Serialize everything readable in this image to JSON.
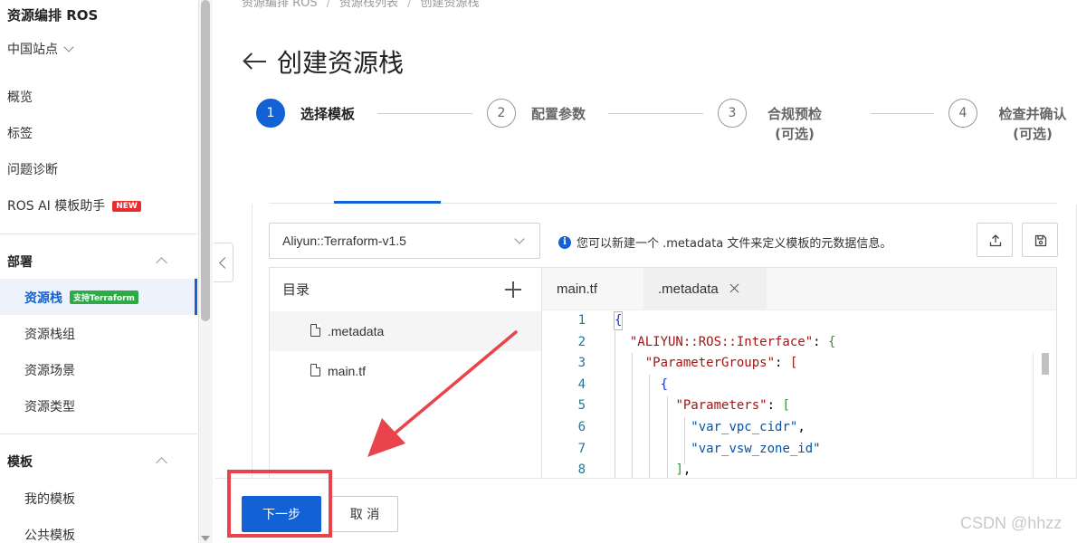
{
  "sidebar": {
    "title": "资源编排 ROS",
    "region": "中国站点",
    "items": [
      {
        "label": "概览"
      },
      {
        "label": "标签"
      },
      {
        "label": "问题诊断"
      },
      {
        "label": "ROS AI 模板助手",
        "badge": "NEW"
      }
    ],
    "sections": [
      {
        "label": "部署",
        "items": [
          {
            "label": "资源栈",
            "badge": "支持Terraform",
            "active": true
          },
          {
            "label": "资源栈组"
          },
          {
            "label": "资源场景"
          },
          {
            "label": "资源类型"
          }
        ]
      },
      {
        "label": "模板",
        "items": [
          {
            "label": "我的模板"
          },
          {
            "label": "公共模板"
          }
        ]
      }
    ]
  },
  "breadcrumb": [
    "资源编排 ROS",
    "资源栈列表",
    "创建资源栈"
  ],
  "page_title": "创建资源栈",
  "steps": [
    {
      "num": "1",
      "label": "选择模板",
      "sub": "",
      "active": true
    },
    {
      "num": "2",
      "label": "配置参数",
      "sub": "",
      "active": false
    },
    {
      "num": "3",
      "label": "合规预检",
      "sub": "(可选)",
      "active": false
    },
    {
      "num": "4",
      "label": "检查并确认",
      "sub": "(可选)",
      "active": false
    }
  ],
  "template_select": {
    "value": "Aliyun::Terraform-v1.5"
  },
  "info_text": "您可以新建一个 .metadata 文件来定义模板的元数据信息。",
  "file_tree": {
    "title": "目录",
    "files": [
      ".metadata",
      "main.tf"
    ],
    "selected": ".metadata"
  },
  "editor": {
    "tabs": [
      {
        "label": "main.tf",
        "active": false,
        "closable": false
      },
      {
        "label": ".metadata",
        "active": true,
        "closable": true
      }
    ],
    "line_numbers": [
      "1",
      "2",
      "3",
      "4",
      "5",
      "6",
      "7",
      "8"
    ]
  },
  "buttons": {
    "next": "下一步",
    "cancel": "取 消"
  },
  "watermark": "CSDN @hhzz",
  "colors": {
    "primary": "#1262d6",
    "highlight": "#e9444c",
    "tf_badge": "#2eaa47",
    "new_badge": "#e62e2e"
  }
}
